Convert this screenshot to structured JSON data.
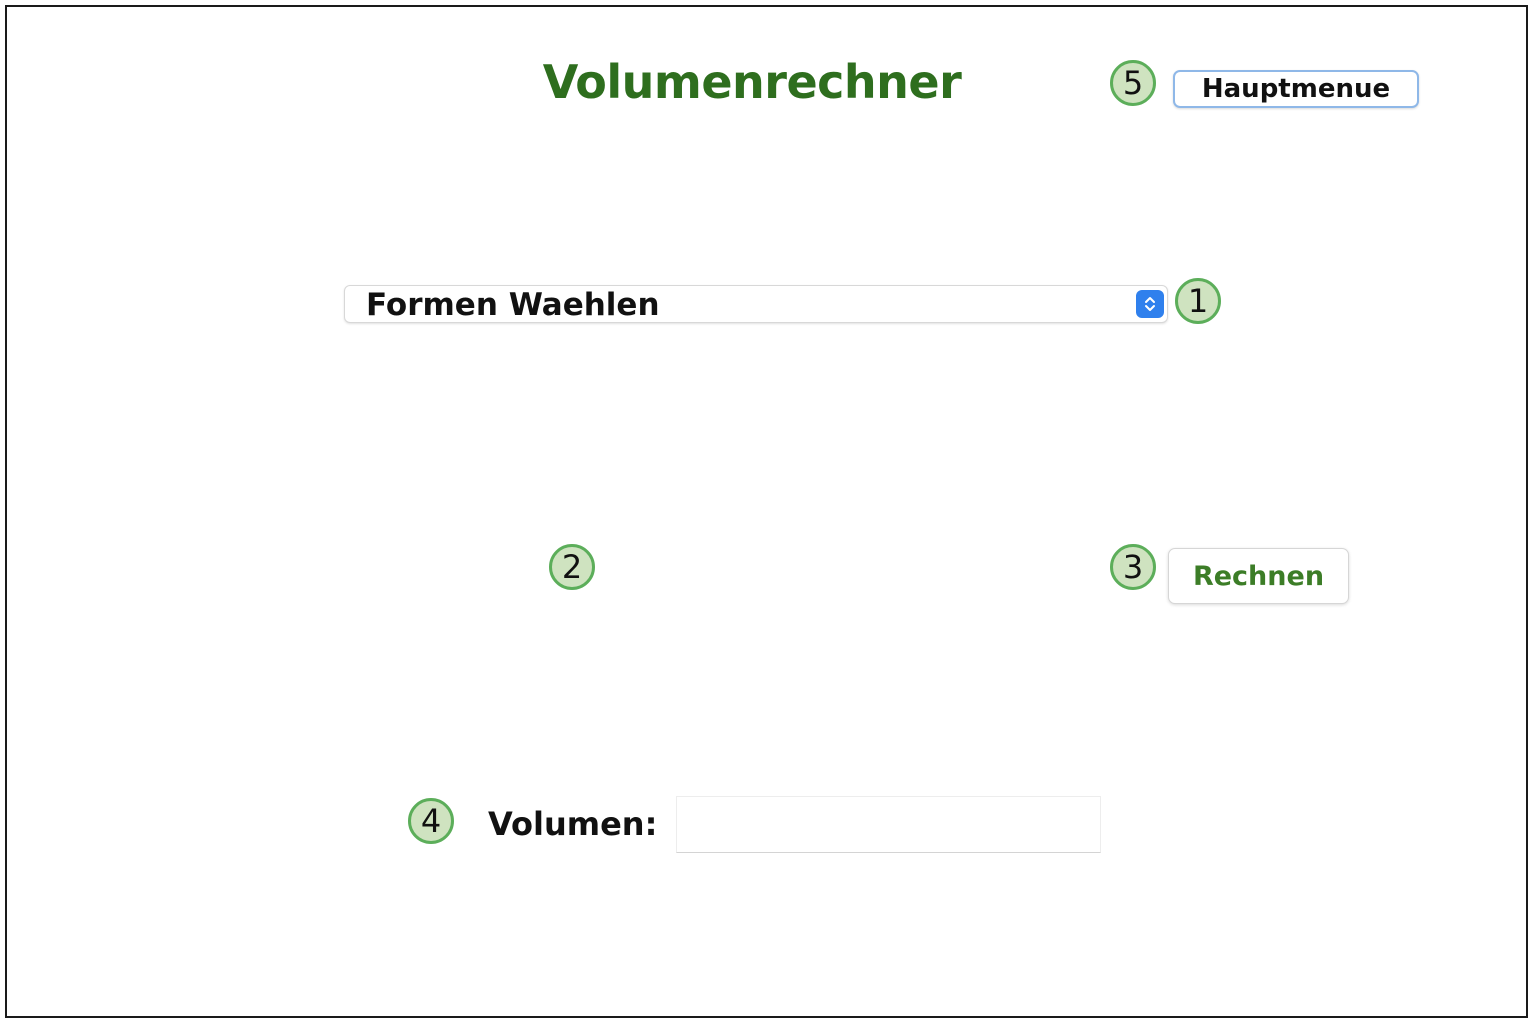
{
  "header": {
    "title": "Volumenrechner",
    "main_menu_label": "Hauptmenue"
  },
  "shape_select": {
    "selected": "Formen Waehlen"
  },
  "calculate_label": "Rechnen",
  "result": {
    "label": "Volumen:",
    "value": ""
  },
  "markers": {
    "shape_select": "1",
    "input_area": "2",
    "calculate": "3",
    "result": "4",
    "main_menu": "5"
  },
  "colors": {
    "title": "#2e6e1e",
    "calculate_text": "#3c7d27",
    "marker_fill": "#cfe3c0",
    "marker_border": "#5cae5a",
    "select_accent": "#2f80ed",
    "main_menu_border": "#8fb8e8"
  }
}
